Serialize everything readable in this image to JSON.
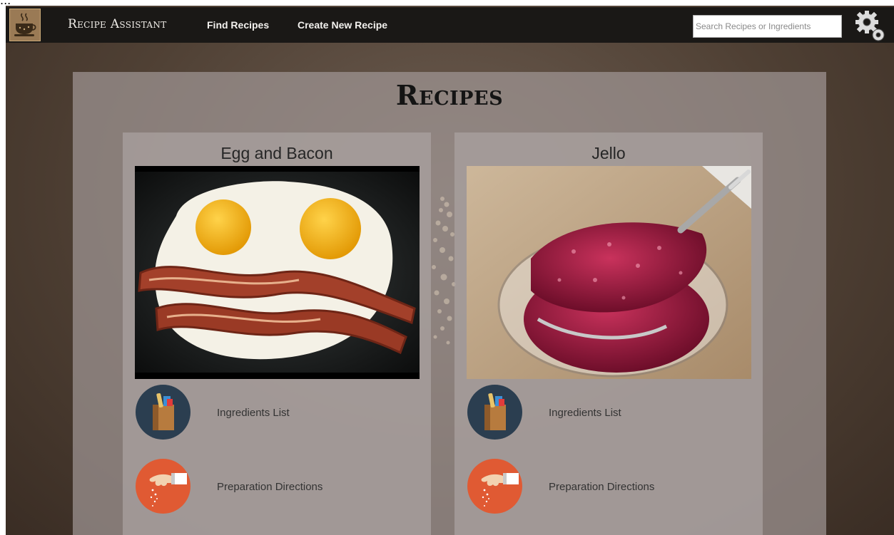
{
  "header": {
    "brand": "Recipe Assistant",
    "nav": {
      "find": "Find Recipes",
      "create": "Create New Recipe"
    },
    "search": {
      "placeholder": "Search Recipes or Ingredients",
      "value": ""
    }
  },
  "main": {
    "title": "Recipes",
    "recipes": [
      {
        "name": "Egg and Bacon",
        "ingredients_label": "Ingredients List",
        "directions_label": "Preparation Directions"
      },
      {
        "name": "Jello",
        "ingredients_label": "Ingredients List",
        "directions_label": "Preparation Directions"
      }
    ]
  },
  "icons": {
    "logo": "coffee-cup-icon",
    "settings": "gears-icon",
    "ingredients": "grocery-bag-icon",
    "directions": "salt-pinch-hand-icon"
  },
  "colors": {
    "navbar": "#1a1816",
    "background": "#4f4034",
    "ingredients_icon_bg": "#2b3e50",
    "directions_icon_bg": "#e05a33"
  }
}
